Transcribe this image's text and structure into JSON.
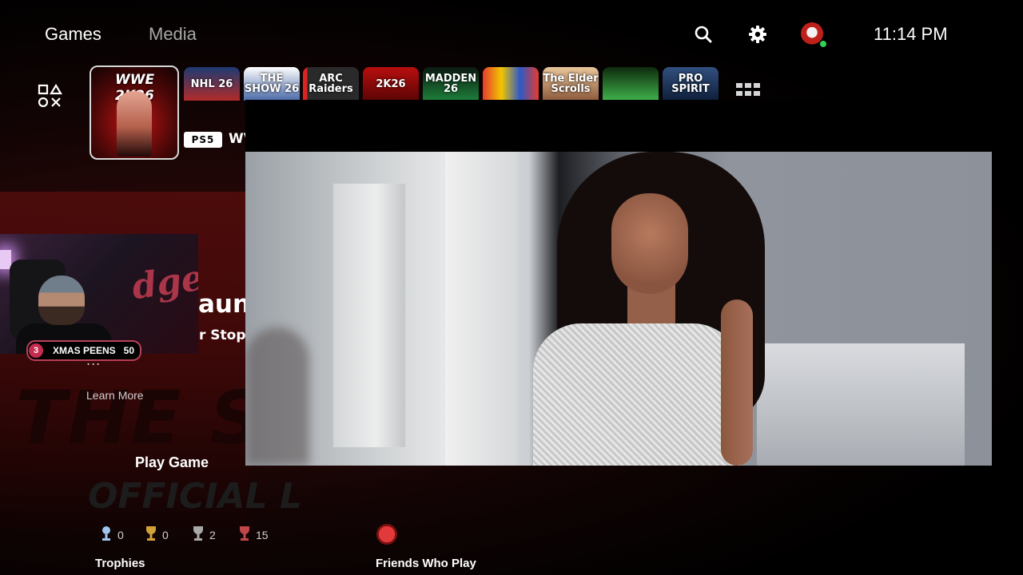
{
  "nav": {
    "tabs": [
      {
        "label": "Games"
      },
      {
        "label": "Media"
      }
    ]
  },
  "header": {
    "clock": "11:14 PM",
    "online_color": "#2fd35a"
  },
  "icons": {
    "search": "search-icon",
    "settings": "gear-icon",
    "library": "game-library-icon",
    "all_games": "all-games-icon"
  },
  "game_row": {
    "selected": {
      "logo_text": "WWE 2K26"
    },
    "tiles": [
      {
        "text": "NHL 26",
        "bg": "linear-gradient(180deg,#1d3b72,#b22b2b)"
      },
      {
        "text": "THE SHOW 26",
        "bg": "linear-gradient(180deg,#ffffff,#4a6aa8)"
      },
      {
        "text": "ARC Raiders",
        "bg": "linear-gradient(90deg,#d22 0 8%,#2a2a2a 8%)"
      },
      {
        "text": "2K26",
        "bg": "linear-gradient(180deg,#b80f0f,#5c0404)"
      },
      {
        "text": "MADDEN 26",
        "bg": "linear-gradient(180deg,#0b1a10,#1e7f3b)"
      },
      {
        "text": "",
        "bg": "linear-gradient(90deg,#e53b2f,#f2c500,#2c59c8,#e53b2f)"
      },
      {
        "text": "The Elder Scrolls",
        "bg": "linear-gradient(180deg,#e9c69b,#8c5a3b)"
      },
      {
        "text": "",
        "bg": "linear-gradient(180deg,#0e2a0e,#3fb24a)"
      },
      {
        "text": "PRO SPIRIT",
        "bg": "linear-gradient(180deg,#31507f,#0f1f3a)"
      }
    ]
  },
  "info": {
    "platform_badge": "PS5",
    "title_partial": "WV",
    "event_title_partial": "aun",
    "event_subtitle_partial": "r Stops",
    "learn_more": "Learn More",
    "play_button": "Play Game",
    "more": "..."
  },
  "webcam_overlay": {
    "badge": {
      "count": "3",
      "label": "XMAS PEENS",
      "goal": "50"
    },
    "banner_text": "dgers"
  },
  "background": {
    "title_text": "THE SH",
    "subtitle_text": "OFFICIAL L"
  },
  "trophies": {
    "label": "Trophies",
    "items": [
      {
        "type": "platinum",
        "count": "0",
        "color": "#9fc6ef"
      },
      {
        "type": "gold",
        "count": "0",
        "color": "#d2a238"
      },
      {
        "type": "silver",
        "count": "2",
        "color": "#a9a9a9"
      },
      {
        "type": "bronze",
        "count": "15",
        "color": "#c0464a"
      }
    ]
  },
  "friends": {
    "label": "Friends Who Play"
  }
}
